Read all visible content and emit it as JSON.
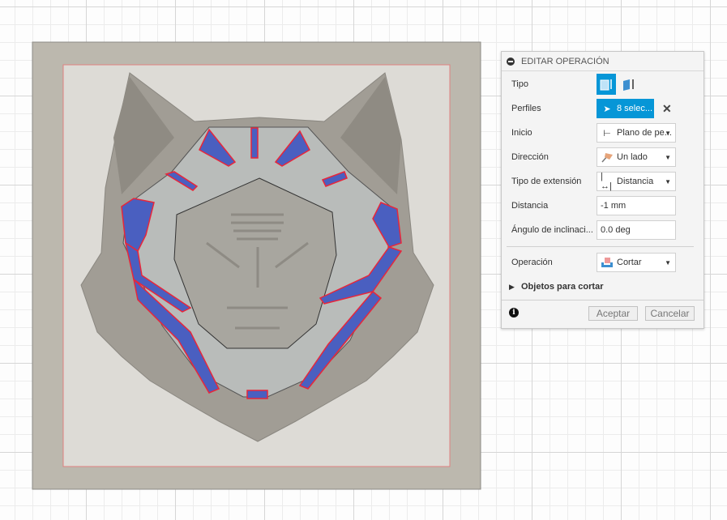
{
  "dialog": {
    "title": "EDITAR OPERACIÓN",
    "rows": {
      "tipo": {
        "label": "Tipo",
        "icons": [
          "solid-extrude-icon",
          "surface-extrude-icon"
        ]
      },
      "perfiles": {
        "label": "Perfiles",
        "value": "8 selec..."
      },
      "inicio": {
        "label": "Inicio",
        "value": "Plano de pe..."
      },
      "direccion": {
        "label": "Dirección",
        "value": "Un lado"
      },
      "tipo_extension": {
        "label": "Tipo de extensión",
        "value": "Distancia"
      },
      "distancia": {
        "label": "Distancia",
        "value": "-1 mm"
      },
      "angulo": {
        "label": "Ángulo de inclinaci...",
        "value": "0.0 deg"
      },
      "operacion": {
        "label": "Operación",
        "value": "Cortar"
      }
    },
    "objetos_label": "Objetos para cortar",
    "accept_label": "Aceptar",
    "cancel_label": "Cancelar"
  },
  "viewport": {
    "model_colors": {
      "plate": "#bcb8ae",
      "inner": "#d9d7d2",
      "profile": "#4a5fc0",
      "highlight": "#e8263a"
    }
  }
}
